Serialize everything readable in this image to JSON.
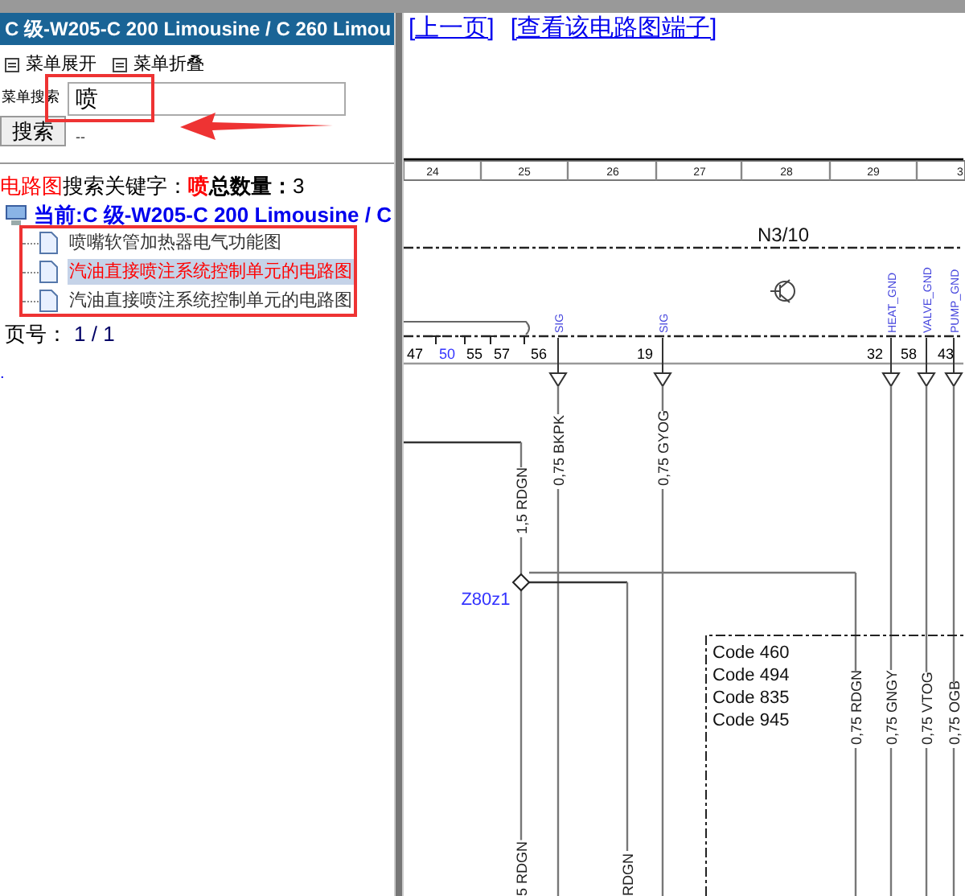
{
  "menu_panel": {
    "title": "C 级-W205-C 200 Limousine / C 260 Limou",
    "toggles": [
      {
        "label": "菜单展开"
      },
      {
        "label": "菜单折叠"
      }
    ],
    "search": {
      "label": "菜单搜索",
      "value": "喷",
      "button": "搜索",
      "extra": "--"
    },
    "result_summary": {
      "prefix": "电路图",
      "keyword_label": "搜索关键字：",
      "keyword": "喷",
      "count_label": "总数量：",
      "count": "3"
    },
    "tree": {
      "label": "当前:C 级-W205-C 200 Limousine / C",
      "expanded": true,
      "children": [
        {
          "label": "喷嘴软管加热器电气功能图",
          "selected": false
        },
        {
          "label": "汽油直接喷注系统控制单元的电路图",
          "selected": true
        },
        {
          "label": "汽油直接喷注系统控制单元的电路图",
          "selected": false
        }
      ]
    },
    "pager": {
      "label": "页号：",
      "value": "1 / 1"
    },
    "footer_mark": "."
  },
  "links": [
    "[上一页]",
    "[查看该电路图端子]"
  ],
  "diagram": {
    "columns": [
      "24",
      "25",
      "26",
      "27",
      "28",
      "29",
      "3"
    ],
    "component": "N3/10",
    "pins": [
      {
        "label": "47",
        "color": "#000000"
      },
      {
        "label": "50",
        "color": "#3333ff"
      },
      {
        "label": "55",
        "color": "#000000"
      },
      {
        "label": "57",
        "color": "#000000"
      },
      {
        "label": "56",
        "color": "#000000"
      },
      {
        "label": "19",
        "color": "#000000"
      },
      {
        "label": "32",
        "color": "#000000"
      },
      {
        "label": "58",
        "color": "#000000"
      },
      {
        "label": "43",
        "color": "#000000"
      }
    ],
    "pin_names": [
      "SIG",
      "SIG",
      "HEAT_GND",
      "VALVE_GND",
      "PUMP_GND"
    ],
    "wire_labels": [
      "1,5 RDGN",
      "0,75 BKPK",
      "0,75 GYOG",
      "0,75 RDGN",
      "0,75 GNGY",
      "0,75 VTOG",
      "0,75 OGB",
      "5 RDGN",
      "RDGN"
    ],
    "connector": "Z80z1",
    "codes": [
      "Code 460",
      "Code 494",
      "Code 835",
      "Code 945"
    ]
  }
}
